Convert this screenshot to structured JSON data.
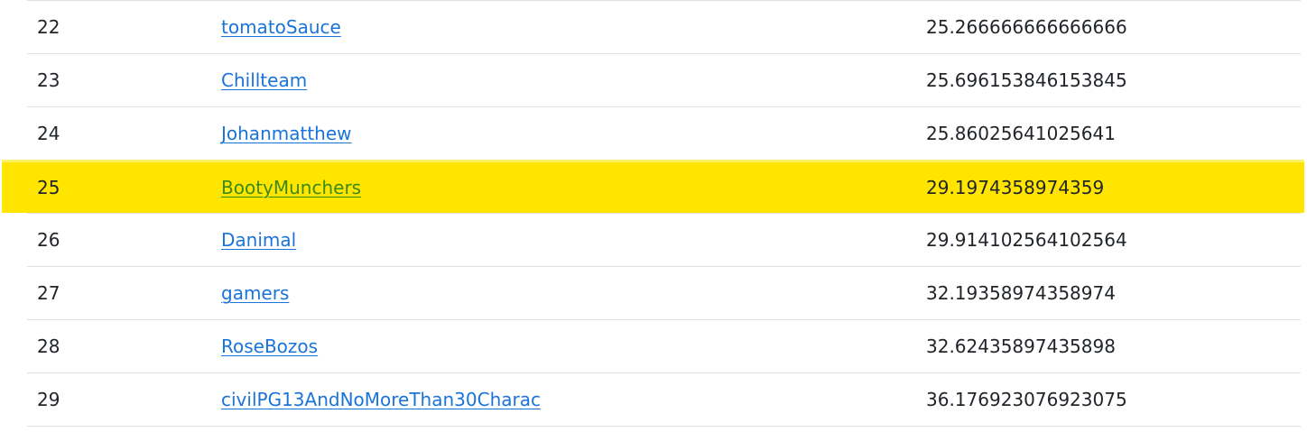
{
  "leaderboard": {
    "highlight_color": "#ffe500",
    "link_color": "#1a73d9",
    "rows": [
      {
        "rank": "22",
        "team": "tomatoSauce",
        "score": "25.266666666666666"
      },
      {
        "rank": "23",
        "team": "Chillteam",
        "score": "25.696153846153845"
      },
      {
        "rank": "24",
        "team": "Johanmatthew",
        "score": "25.86025641025641"
      },
      {
        "rank": "25",
        "team": "BootyMunchers",
        "score": "29.1974358974359"
      },
      {
        "rank": "26",
        "team": "Danimal",
        "score": "29.914102564102564"
      },
      {
        "rank": "27",
        "team": "gamers",
        "score": "32.19358974358974"
      },
      {
        "rank": "28",
        "team": "RoseBozos",
        "score": "32.62435897435898"
      },
      {
        "rank": "29",
        "team": "civilPG13AndNoMoreThan30Charac",
        "score": "36.176923076923075"
      }
    ]
  }
}
